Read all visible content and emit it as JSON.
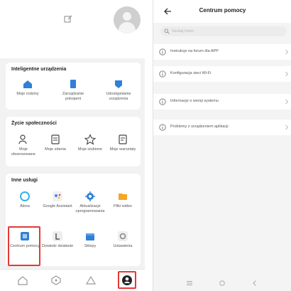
{
  "left_screen": {
    "smart_devices": {
      "title": "Inteligentne urządzenia",
      "items": [
        {
          "label": "Moje rodziny",
          "icon": "home-icon"
        },
        {
          "label": "Zarządzanie pokojami",
          "icon": "room-icon"
        },
        {
          "label": "Udostępnianie urządzenia",
          "icon": "share-device-icon"
        }
      ]
    },
    "social": {
      "title": "Życie społeczności",
      "items": [
        {
          "label": "Moje obserwowane",
          "icon": "user-follow-icon"
        },
        {
          "label": "Moje zdania",
          "icon": "document-icon"
        },
        {
          "label": "Moje ulubione",
          "icon": "star-icon"
        },
        {
          "label": "Moje warsztaty",
          "icon": "clipboard-icon"
        }
      ]
    },
    "other_services": {
      "title": "Inne usługi",
      "items": [
        {
          "label": "Alexa",
          "icon": "alexa-icon"
        },
        {
          "label": "Google Assistant",
          "icon": "google-assistant-icon"
        },
        {
          "label": "Aktualizacje oprogramowania",
          "icon": "firmware-update-icon"
        },
        {
          "label": "Pliki wideo",
          "icon": "video-files-icon"
        },
        {
          "label": "Centrum pomocy",
          "icon": "help-center-icon"
        },
        {
          "label": "Dowiedz działanie",
          "icon": "learn-icon"
        },
        {
          "label": "Sklepy",
          "icon": "store-icon"
        },
        {
          "label": "Ustawienia",
          "icon": "settings-icon"
        }
      ]
    },
    "bottom_nav": [
      "home-nav-icon",
      "smart-nav-icon",
      "community-nav-icon",
      "profile-nav-icon"
    ]
  },
  "right_screen": {
    "title": "Centrum pomocy",
    "search_placeholder": "Szukaj treści",
    "items": [
      {
        "label": "Instrukcje na forum dla APP"
      },
      {
        "label": "Konfiguracja sieci Wi-Fi"
      },
      {
        "label": "Informacje o wersji systemu"
      },
      {
        "label": "Problemy z urządzeniem aplikacji"
      }
    ]
  },
  "colors": {
    "accent_blue": "#2f80d8",
    "highlight_red": "#e53935"
  }
}
